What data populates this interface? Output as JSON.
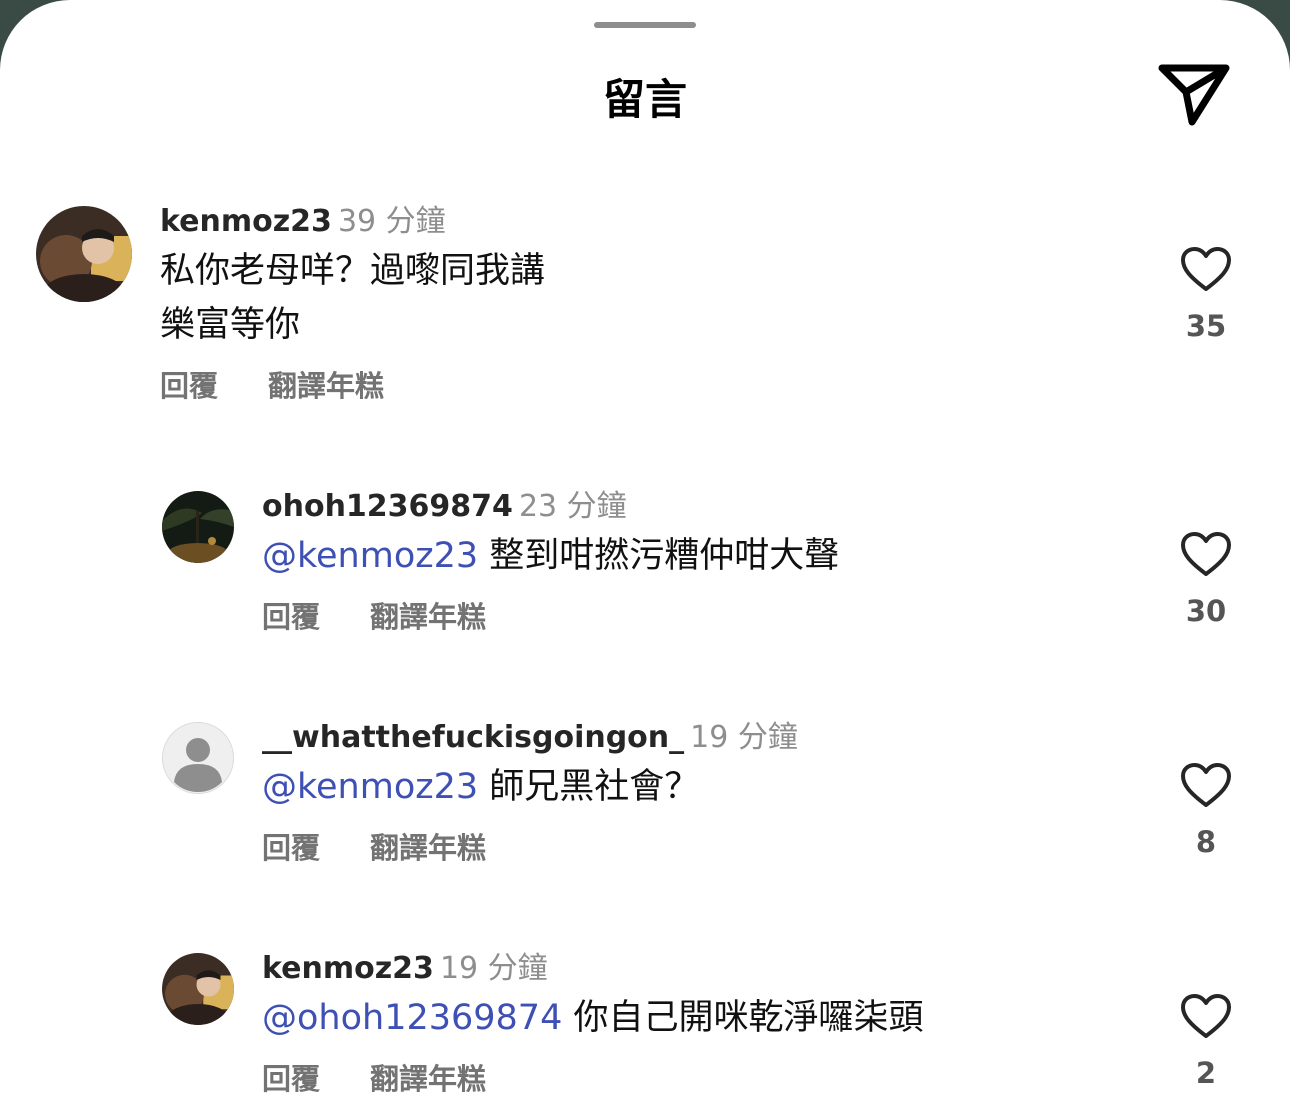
{
  "header": {
    "title": "留言"
  },
  "comments": [
    {
      "username": "kenmoz23",
      "time": "39 分鐘",
      "mention": "",
      "text_line1": "私你老母咩？過嚟同我講",
      "text_line2": "樂富等你",
      "reply_label": "回覆",
      "translate_label": "翻譯年糕",
      "likes": "35"
    },
    {
      "username": "ohoh12369874",
      "time": "23 分鐘",
      "mention": "@kenmoz23",
      "text_line1": "整到咁撚污糟仲咁大聲",
      "reply_label": "回覆",
      "translate_label": "翻譯年糕",
      "likes": "30"
    },
    {
      "username": "__whatthefuckisgoingon_",
      "time": "19 分鐘",
      "mention": "@kenmoz23",
      "text_line1": "師兄黑社會？",
      "reply_label": "回覆",
      "translate_label": "翻譯年糕",
      "likes": "8"
    },
    {
      "username": "kenmoz23",
      "time": "19 分鐘",
      "mention": "@ohoh12369874",
      "text_line1": "你自己開咪乾淨囉柒頭",
      "reply_label": "回覆",
      "translate_label": "翻譯年糕",
      "likes": "2"
    }
  ],
  "icons": {
    "share": "send-icon",
    "like": "heart-icon",
    "default_avatar": "user-silhouette-icon"
  },
  "colors": {
    "mention": "#3e50b4",
    "secondary_text": "#8e8e8e"
  }
}
